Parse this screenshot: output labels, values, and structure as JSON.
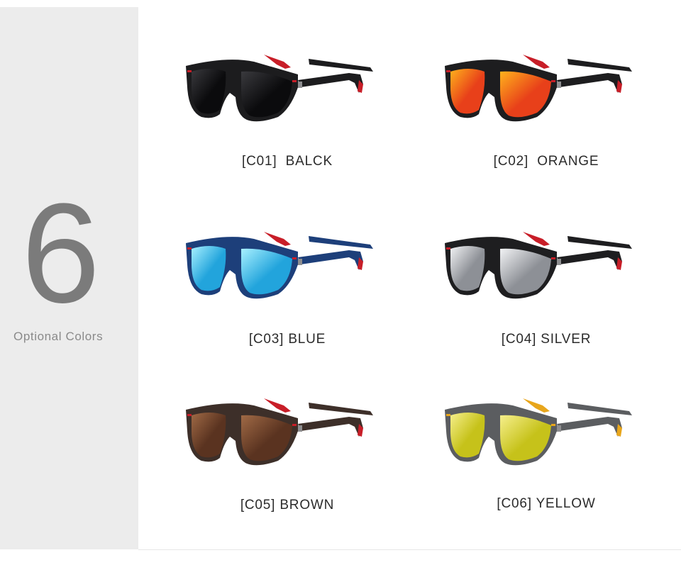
{
  "sidebar": {
    "number": "6",
    "caption": "Optional Colors"
  },
  "variants": [
    {
      "label": "[C01]  BALCK",
      "frame": "#1c1c1e",
      "lens": "#0b0b0d",
      "lens_shine": "#3a3a3e",
      "accent": "#c81e28"
    },
    {
      "label": "[C02]  ORANGE",
      "frame": "#1d1d1f",
      "lens": "#e8401a",
      "lens_shine": "#ffb21c",
      "accent": "#c81e28"
    },
    {
      "label": "[C03] BLUE",
      "frame": "#1d3f7a",
      "lens": "#22a4dc",
      "lens_shine": "#a8f0ff",
      "accent": "#c81e28"
    },
    {
      "label": "[C04] SILVER",
      "frame": "#1e1e20",
      "lens": "#8d9096",
      "lens_shine": "#f2f3f5",
      "accent": "#c81e28"
    },
    {
      "label": "[C05] BROWN",
      "frame": "#3d2f29",
      "lens": "#5a3320",
      "lens_shine": "#a06a46",
      "accent": "#c81e28"
    },
    {
      "label": "[C06] YELLOW",
      "frame": "#5b5d60",
      "lens": "#c6c21a",
      "lens_shine": "#f6ef8c",
      "accent": "#e8a61c"
    }
  ]
}
